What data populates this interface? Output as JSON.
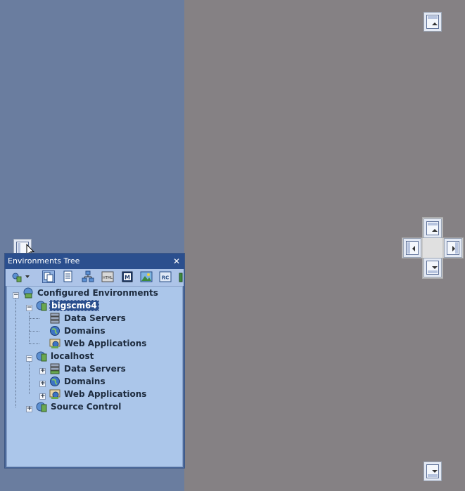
{
  "panel": {
    "title": "Environments Tree",
    "close_glyph": "✕"
  },
  "toolbar": {
    "items": [
      {
        "icon": "environments-dropdown-icon"
      },
      {
        "icon": "copy-icon"
      },
      {
        "icon": "document-icon"
      },
      {
        "icon": "network-icon"
      },
      {
        "icon": "html-icon",
        "label": "HTML"
      },
      {
        "icon": "m-icon",
        "label": "M"
      },
      {
        "icon": "image-icon"
      },
      {
        "icon": "rc-icon",
        "label": "RC"
      }
    ]
  },
  "tree": {
    "root": "Configured Environments",
    "nodes": {
      "bigscm64": "bigscm64",
      "bigscm64_data_servers": "Data Servers",
      "bigscm64_domains": "Domains",
      "bigscm64_web_apps": "Web Applications",
      "localhost": "localhost",
      "localhost_data_servers": "Data Servers",
      "localhost_domains": "Domains",
      "localhost_web_apps": "Web Applications",
      "source_control": "Source Control"
    },
    "selected": "bigscm64"
  },
  "colors": {
    "left_pane": "#6a7d9f",
    "right_pane": "#858184",
    "title_bar": "#2b4f8e",
    "tree_bg": "#abc6ea"
  }
}
